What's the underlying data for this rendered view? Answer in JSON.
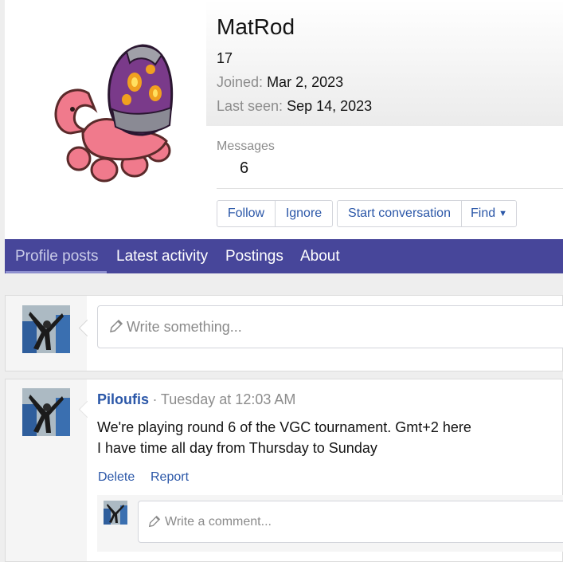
{
  "profile": {
    "username": "MatRod",
    "age": "17",
    "joined_label": "Joined:",
    "joined_value": "Mar 2, 2023",
    "last_seen_label": "Last seen:",
    "last_seen_value": "Sep 14, 2023",
    "messages_label": "Messages",
    "messages_value": "6",
    "avatar_icon": "pokemon-sprite-icon"
  },
  "actions": {
    "follow": "Follow",
    "ignore": "Ignore",
    "start_conversation": "Start conversation",
    "find": "Find"
  },
  "tabs": [
    {
      "label": "Profile posts",
      "active": true
    },
    {
      "label": "Latest activity",
      "active": false
    },
    {
      "label": "Postings",
      "active": false
    },
    {
      "label": "About",
      "active": false
    }
  ],
  "composer": {
    "placeholder": "Write something...",
    "icon": "pencil-icon"
  },
  "post": {
    "author": "Piloufis",
    "separator": "·",
    "time": "Tuesday at 12:03 AM",
    "body_line1": "We're playing round 6 of the VGC tournament. Gmt+2 here",
    "body_line2": "I have time all day from Thursday to Sunday",
    "delete": "Delete",
    "report": "Report",
    "comment_placeholder": "Write a comment..."
  },
  "colors": {
    "accent": "#47469a",
    "link": "#2b57a8",
    "muted": "#8c8c8c"
  }
}
